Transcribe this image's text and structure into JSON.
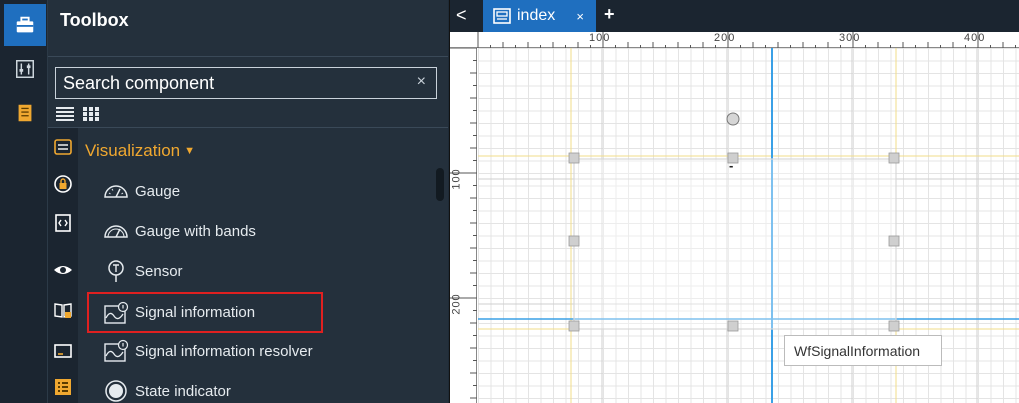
{
  "toolbox": {
    "title": "Toolbox",
    "search_placeholder": "Search component",
    "clear_symbol": "×",
    "category": "Visualization",
    "items": [
      {
        "label": "Gauge",
        "icon": "gauge-icon"
      },
      {
        "label": "Gauge with bands",
        "icon": "gauge-bands-icon"
      },
      {
        "label": "Sensor",
        "icon": "sensor-icon"
      },
      {
        "label": "Signal information",
        "icon": "signal-information-icon",
        "selected": true
      },
      {
        "label": "Signal information resolver",
        "icon": "signal-resolver-icon"
      },
      {
        "label": "State indicator",
        "icon": "state-indicator-icon"
      }
    ]
  },
  "workspace": {
    "tab_label": "index",
    "tab_close": "×",
    "tab_add": "+",
    "tab_back": "<",
    "ruler_top_labels": [
      "100",
      "200",
      "300",
      "400"
    ],
    "ruler_left_labels": [
      "100",
      "200"
    ],
    "element_value": "-",
    "tooltip": "WfSignalInformation"
  },
  "colors": {
    "accent": "#1f6fbf",
    "category": "#f0a830",
    "selection_outline": "#e02020",
    "guide_yellow": "#f2dc8a",
    "guide_blue": "#3aa0e6"
  }
}
